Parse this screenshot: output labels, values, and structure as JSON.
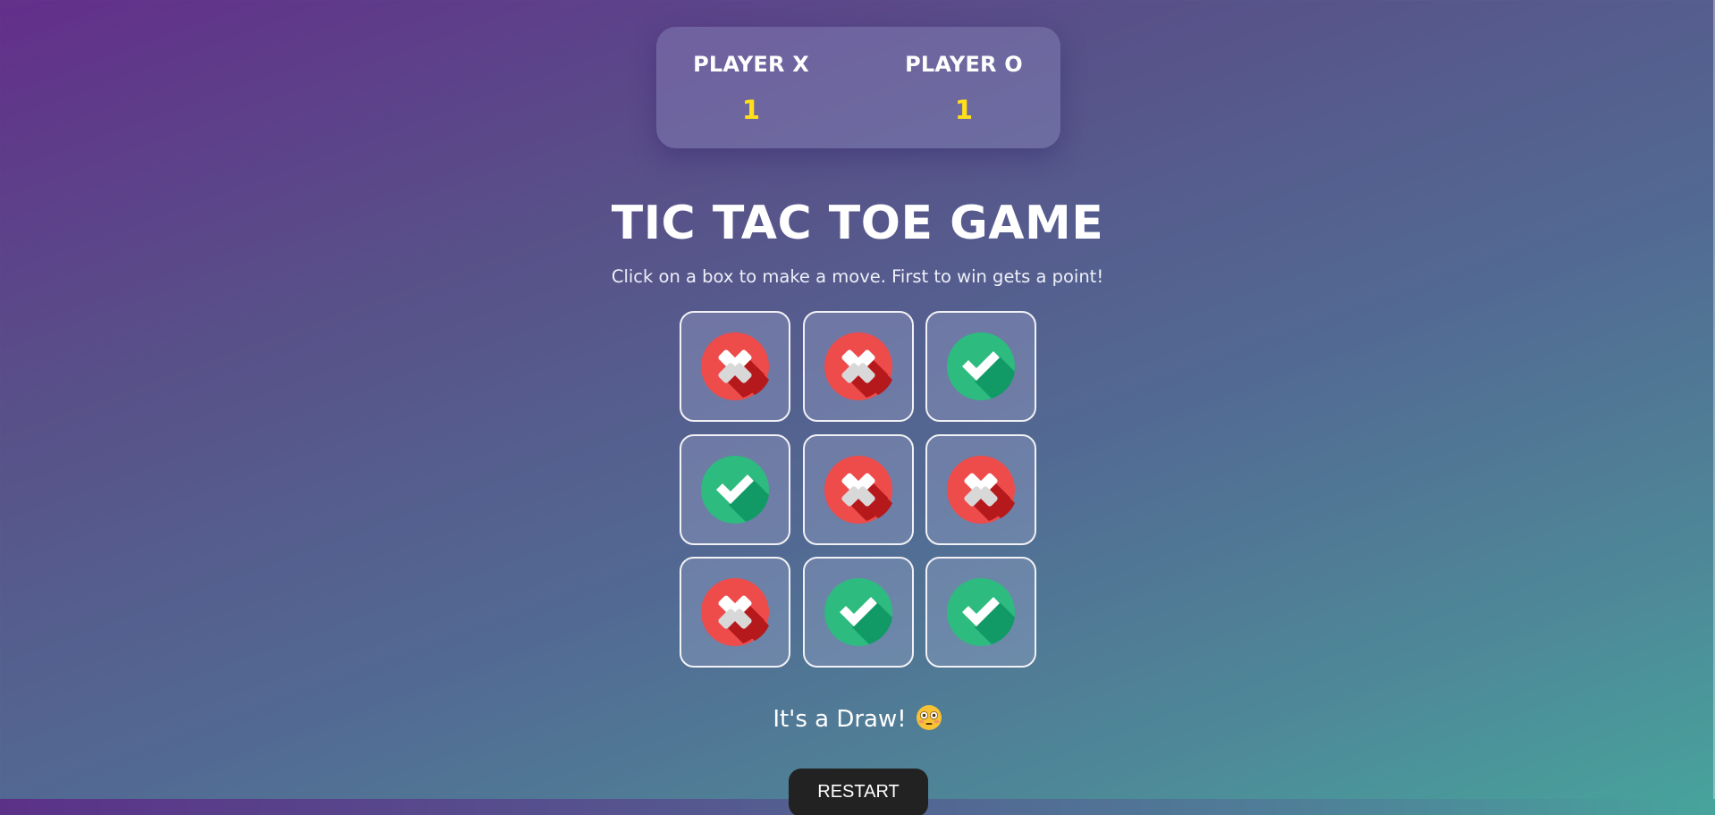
{
  "scoreboard": {
    "player_x": {
      "label": "PLAYER X",
      "score": "1"
    },
    "player_o": {
      "label": "PLAYER O",
      "score": "1"
    }
  },
  "title": "TIC TAC TOE GAME",
  "subtitle": "Click on a box to make a move. First to win gets a point!",
  "board": [
    "cross-icon",
    "cross-icon",
    "check-icon",
    "check-icon",
    "cross-icon",
    "cross-icon",
    "cross-icon",
    "check-icon",
    "check-icon"
  ],
  "status": {
    "text": "It's a Draw!",
    "emoji": "flushed-face-icon"
  },
  "restart_label": "RESTART",
  "colors": {
    "cross": "#ee4b4b",
    "check": "#2dbb7f",
    "score": "#ffe01a",
    "restart_bg": "#222222"
  }
}
